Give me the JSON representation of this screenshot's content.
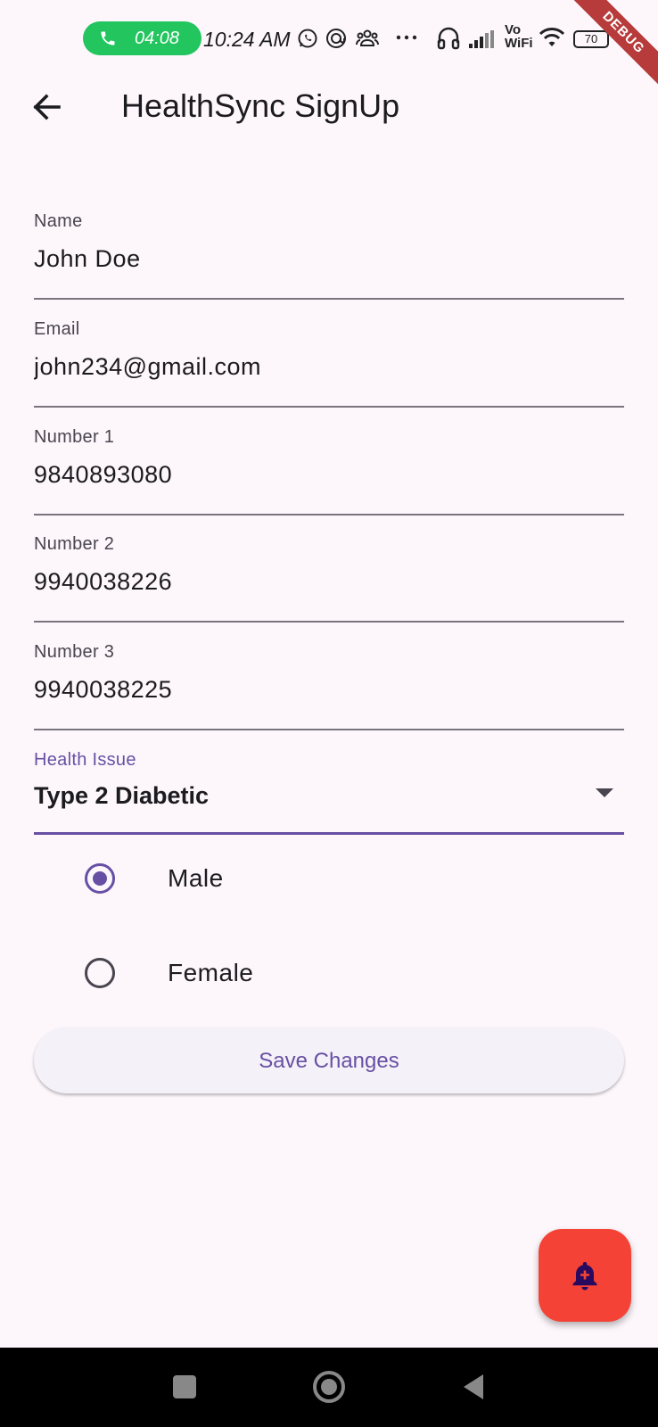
{
  "status_bar": {
    "call_timer": "04:08",
    "time": "10:24 AM",
    "battery": "70",
    "vo_wifi_top": "Vo",
    "vo_wifi_bottom": "WiFi"
  },
  "debug_banner": "DEBUG",
  "app_bar": {
    "title": "HealthSync SignUp"
  },
  "form": {
    "fields": [
      {
        "label": "Name",
        "value": "John Doe"
      },
      {
        "label": "Email",
        "value": "john234@gmail.com"
      },
      {
        "label": "Number 1",
        "value": "9840893080"
      },
      {
        "label": "Number 2",
        "value": "9940038226"
      },
      {
        "label": "Number 3",
        "value": "9940038225"
      }
    ],
    "health_issue": {
      "label": "Health Issue",
      "value": "Type 2 Diabetic"
    },
    "gender_options": [
      {
        "label": "Male",
        "selected": true
      },
      {
        "label": "Female",
        "selected": false
      }
    ],
    "save_label": "Save Changes"
  },
  "colors": {
    "primary": "#6750a4",
    "fab": "#f44336",
    "call_pill": "#22c55e",
    "background": "#fdf7fc"
  },
  "icons": {
    "back": "arrow-left-icon",
    "fab": "bell-plus-icon",
    "nav_recent": "square-icon",
    "nav_home": "circle-icon",
    "nav_back": "triangle-back-icon"
  }
}
